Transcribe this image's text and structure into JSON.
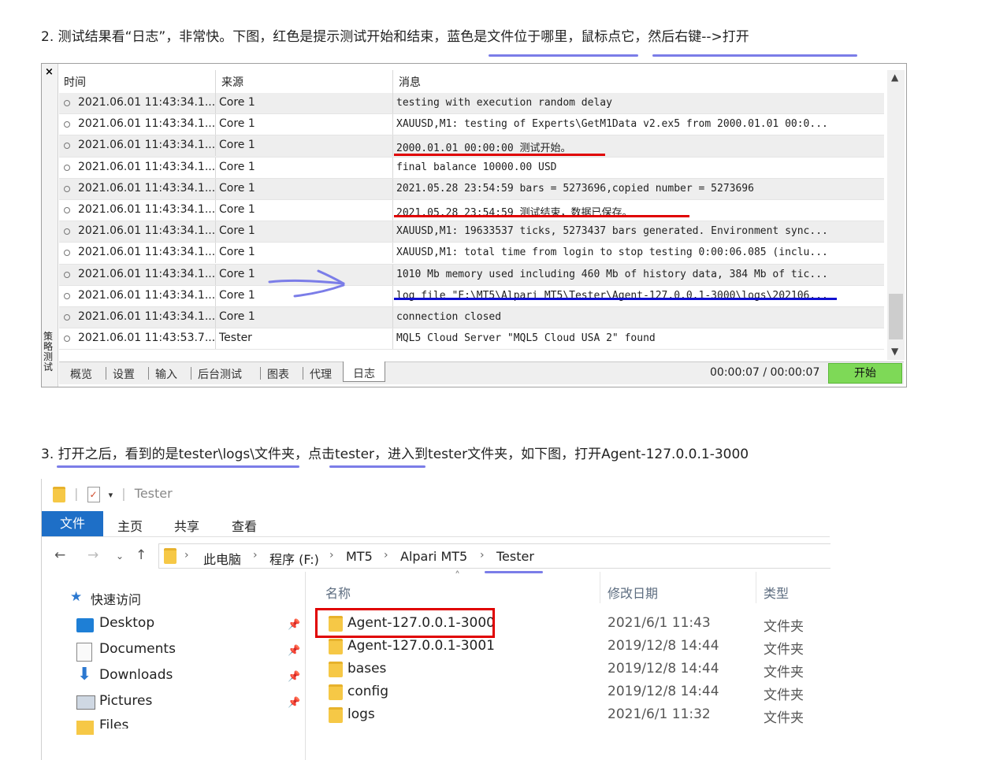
{
  "step2": {
    "text": "2. 测试结果看“日志”，非常快。下图，红色是提示测试开始和结束，蓝色是文件位于哪里，鼠标点它，然后右键-->打开"
  },
  "tester": {
    "close": "×",
    "side_label": "策略测试",
    "headers": {
      "time": "时间",
      "source": "来源",
      "message": "消息"
    },
    "rows": [
      {
        "time": "2021.06.01 11:43:34.1...",
        "source": "Core 1",
        "message": "testing with execution random delay"
      },
      {
        "time": "2021.06.01 11:43:34.1...",
        "source": "Core 1",
        "message": "XAUUSD,M1: testing of Experts\\GetM1Data v2.ex5 from 2000.01.01 00:0..."
      },
      {
        "time": "2021.06.01 11:43:34.1...",
        "source": "Core 1",
        "message": "2000.01.01 00:00:00   测试开始。"
      },
      {
        "time": "2021.06.01 11:43:34.1...",
        "source": "Core 1",
        "message": "final balance 10000.00 USD"
      },
      {
        "time": "2021.06.01 11:43:34.1...",
        "source": "Core 1",
        "message": "2021.05.28 23:54:59   bars = 5273696,copied number = 5273696"
      },
      {
        "time": "2021.06.01 11:43:34.1...",
        "source": "Core 1",
        "message": "2021.05.28 23:54:59   测试结束，数据已保存。"
      },
      {
        "time": "2021.06.01 11:43:34.1...",
        "source": "Core 1",
        "message": "XAUUSD,M1: 19633537 ticks, 5273437 bars generated. Environment sync..."
      },
      {
        "time": "2021.06.01 11:43:34.1...",
        "source": "Core 1",
        "message": "XAUUSD,M1: total time from login to stop testing 0:00:06.085 (inclu..."
      },
      {
        "time": "2021.06.01 11:43:34.1...",
        "source": "Core 1",
        "message": "1010 Mb memory used including 460 Mb of history data, 384 Mb of tic..."
      },
      {
        "time": "2021.06.01 11:43:34.1...",
        "source": "Core 1",
        "message": "log file \"F:\\MT5\\Alpari MT5\\Tester\\Agent-127.0.0.1-3000\\logs\\202106..."
      },
      {
        "time": "2021.06.01 11:43:34.1...",
        "source": "Core 1",
        "message": "connection closed"
      },
      {
        "time": "2021.06.01 11:43:53.7...",
        "source": "Tester",
        "message": "MQL5 Cloud Server \"MQL5 Cloud USA 2\" found"
      }
    ],
    "tabs": [
      "概览",
      "设置",
      "输入",
      "后台测试",
      "图表",
      "代理",
      "日志"
    ],
    "timer": "00:00:07 / 00:00:07",
    "start_button": "开始"
  },
  "step3": {
    "text": "3. 打开之后，看到的是tester\\logs\\文件夹，点击tester，进入到tester文件夹，如下图，打开Agent-127.0.0.1-3000"
  },
  "explorer": {
    "title": "Tester",
    "ribbon_tabs": [
      "文件",
      "主页",
      "共享",
      "查看"
    ],
    "breadcrumb": [
      "此电脑",
      "程序 (F:)",
      "MT5",
      "Alpari MT5",
      "Tester"
    ],
    "nav": {
      "quick_access": "快速访问",
      "items": [
        "Desktop",
        "Documents",
        "Downloads",
        "Pictures",
        "Files"
      ]
    },
    "columns": {
      "name": "名称",
      "date": "修改日期",
      "type": "类型"
    },
    "files": [
      {
        "name": "Agent-127.0.0.1-3000",
        "date": "2021/6/1 11:43",
        "type": "文件夹"
      },
      {
        "name": "Agent-127.0.0.1-3001",
        "date": "2019/12/8 14:44",
        "type": "文件夹"
      },
      {
        "name": "bases",
        "date": "2019/12/8 14:44",
        "type": "文件夹"
      },
      {
        "name": "config",
        "date": "2019/12/8 14:44",
        "type": "文件夹"
      },
      {
        "name": "logs",
        "date": "2021/6/1 11:32",
        "type": "文件夹"
      }
    ]
  },
  "colors": {
    "annotation_red": "#e00000",
    "annotation_blue": "#1010d0",
    "underline_purple": "#7b7de8",
    "start_green": "#7ed957",
    "ribbon_blue": "#1e6fc7"
  }
}
